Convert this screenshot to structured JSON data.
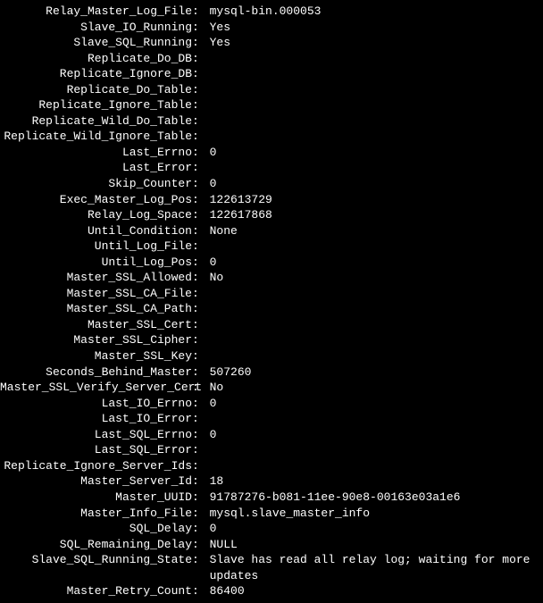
{
  "status": {
    "rows": [
      {
        "key": "Relay_Master_Log_File",
        "value": "mysql-bin.000053"
      },
      {
        "key": "Slave_IO_Running",
        "value": "Yes"
      },
      {
        "key": "Slave_SQL_Running",
        "value": "Yes"
      },
      {
        "key": "Replicate_Do_DB",
        "value": ""
      },
      {
        "key": "Replicate_Ignore_DB",
        "value": ""
      },
      {
        "key": "Replicate_Do_Table",
        "value": ""
      },
      {
        "key": "Replicate_Ignore_Table",
        "value": ""
      },
      {
        "key": "Replicate_Wild_Do_Table",
        "value": ""
      },
      {
        "key": "Replicate_Wild_Ignore_Table",
        "value": ""
      },
      {
        "key": "Last_Errno",
        "value": "0"
      },
      {
        "key": "Last_Error",
        "value": ""
      },
      {
        "key": "Skip_Counter",
        "value": "0"
      },
      {
        "key": "Exec_Master_Log_Pos",
        "value": "122613729"
      },
      {
        "key": "Relay_Log_Space",
        "value": "122617868"
      },
      {
        "key": "Until_Condition",
        "value": "None"
      },
      {
        "key": "Until_Log_File",
        "value": ""
      },
      {
        "key": "Until_Log_Pos",
        "value": "0"
      },
      {
        "key": "Master_SSL_Allowed",
        "value": "No"
      },
      {
        "key": "Master_SSL_CA_File",
        "value": ""
      },
      {
        "key": "Master_SSL_CA_Path",
        "value": ""
      },
      {
        "key": "Master_SSL_Cert",
        "value": ""
      },
      {
        "key": "Master_SSL_Cipher",
        "value": ""
      },
      {
        "key": "Master_SSL_Key",
        "value": ""
      },
      {
        "key": "Seconds_Behind_Master",
        "value": "507260"
      },
      {
        "key": "Master_SSL_Verify_Server_Cert",
        "value": "No"
      },
      {
        "key": "Last_IO_Errno",
        "value": "0"
      },
      {
        "key": "Last_IO_Error",
        "value": ""
      },
      {
        "key": "Last_SQL_Errno",
        "value": "0"
      },
      {
        "key": "Last_SQL_Error",
        "value": ""
      },
      {
        "key": "Replicate_Ignore_Server_Ids",
        "value": ""
      },
      {
        "key": "Master_Server_Id",
        "value": "18"
      },
      {
        "key": "Master_UUID",
        "value": "91787276-b081-11ee-90e8-00163e03a1e6"
      },
      {
        "key": "Master_Info_File",
        "value": "mysql.slave_master_info"
      },
      {
        "key": "SQL_Delay",
        "value": "0"
      },
      {
        "key": "SQL_Remaining_Delay",
        "value": "NULL"
      },
      {
        "key": "Slave_SQL_Running_State",
        "value": "Slave has read all relay log; waiting for more updates"
      },
      {
        "key": "Master_Retry_Count",
        "value": "86400"
      }
    ]
  }
}
